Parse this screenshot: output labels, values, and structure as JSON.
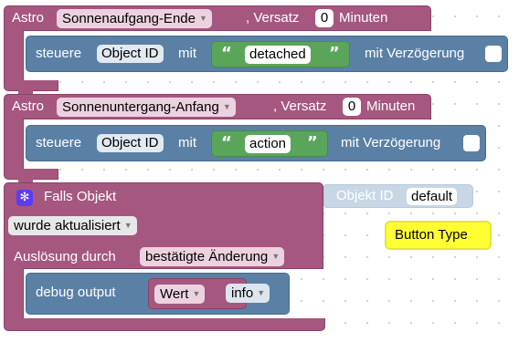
{
  "block1": {
    "astro_label": "Astro",
    "event_value": "Sonnenaufgang-Ende",
    "offset_label": ", Versatz",
    "offset_value": "0",
    "minutes_label": "Minuten",
    "control": {
      "label": "steuere",
      "object_id": "Object ID",
      "with_label": "mit",
      "value": "detached",
      "delay_label": "mit Verzögerung"
    }
  },
  "block2": {
    "astro_label": "Astro",
    "event_value": "Sonnenuntergang-Anfang",
    "offset_label": ", Versatz",
    "offset_value": "0",
    "minutes_label": "Minuten",
    "control": {
      "label": "steuere",
      "object_id": "Object ID",
      "with_label": "mit",
      "value": "action",
      "delay_label": "mit Verzögerung"
    }
  },
  "block3": {
    "title": "Falls Objekt",
    "condition_value": "wurde aktualisiert",
    "trigger_label": "Auslösung durch",
    "trigger_value": "bestätigte Änderung",
    "debug": {
      "label": "debug output",
      "value_dropdown": "Wert",
      "level_dropdown": "info"
    },
    "object_id_label": "Objekt ID",
    "object_id_value": "default"
  },
  "comment": {
    "text": "Button Type"
  },
  "colors": {
    "astro_block": "#a5577f",
    "control_block": "#5b80a5",
    "text_block": "#5ba55b",
    "comment": "#ffff33"
  },
  "icons": {
    "gear": "gear-icon",
    "dropdown_arrow": "dropdown-arrow-icon",
    "quote": "quote-icon"
  }
}
